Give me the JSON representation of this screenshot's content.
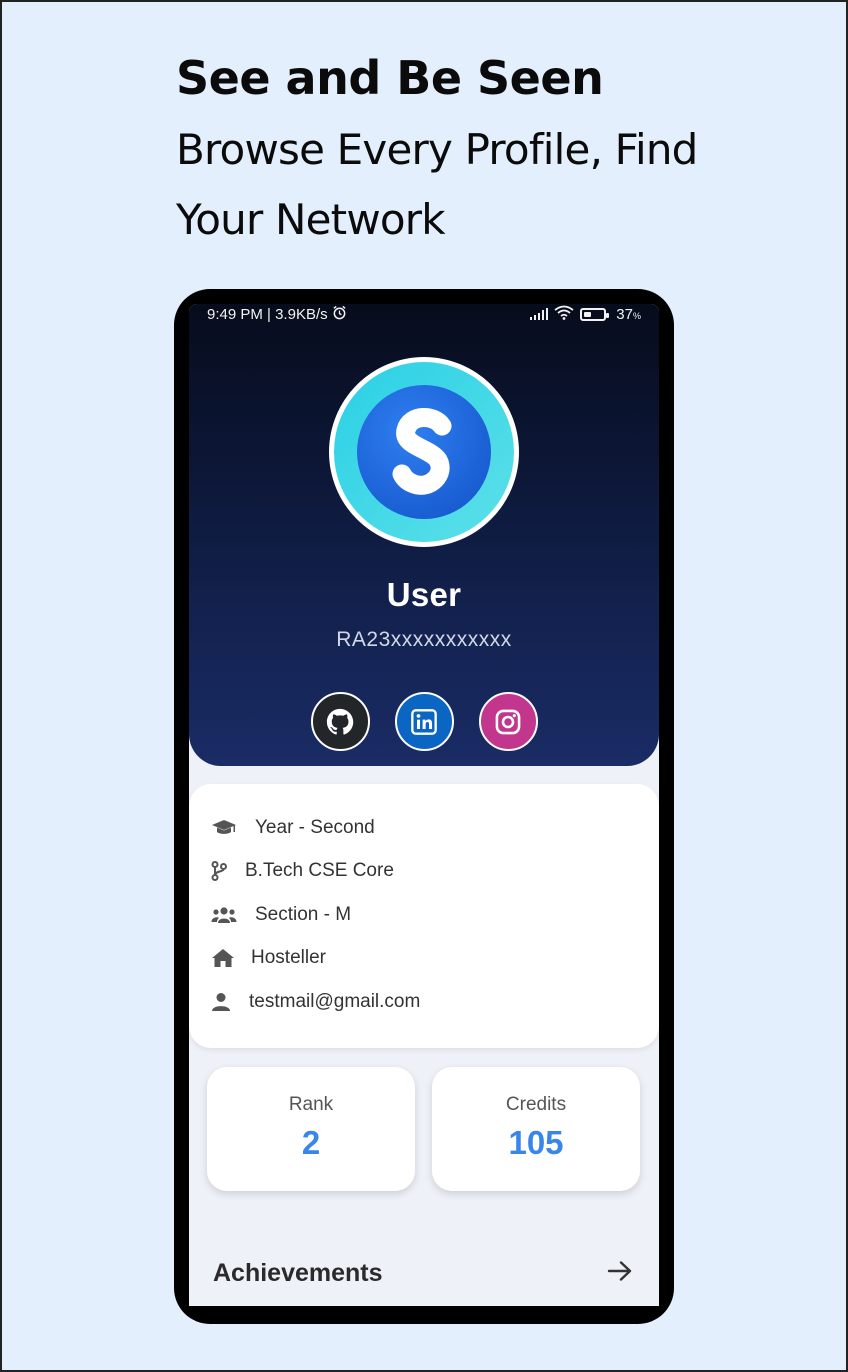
{
  "headline": {
    "title": "See and Be Seen",
    "subtitle_line1": "Browse Every Profile, Find",
    "subtitle_line2": "Your Network"
  },
  "status_bar": {
    "time_speed": "9:49 PM | 3.9KB/s",
    "battery_percent": "37",
    "battery_suffix": "%"
  },
  "profile": {
    "name": "User",
    "id": "RA23xxxxxxxxxxx",
    "socials": [
      "github-icon",
      "linkedin-icon",
      "instagram-icon"
    ]
  },
  "info": {
    "year": "Year - Second",
    "branch": "B.Tech CSE Core",
    "section": "Section - M",
    "residence": "Hosteller",
    "email": "testmail@gmail.com"
  },
  "stats": {
    "rank_label": "Rank",
    "rank_value": "2",
    "credits_label": "Credits",
    "credits_value": "105"
  },
  "achievements": {
    "title": "Achievements"
  },
  "colors": {
    "page_bg": "#e3effc",
    "accent": "#3a86e8",
    "hero_top": "#070c1c",
    "hero_bottom": "#1a2c66"
  }
}
